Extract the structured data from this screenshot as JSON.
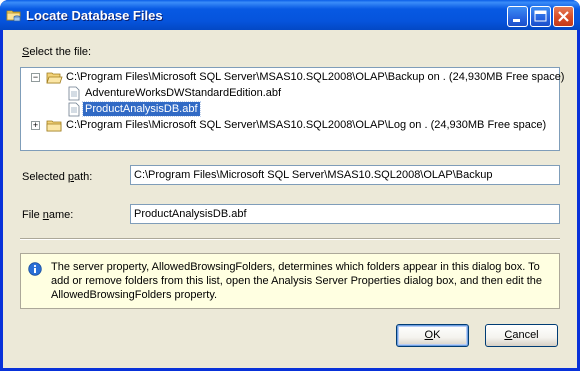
{
  "window": {
    "title": "Locate Database Files",
    "icon": "database-folder-icon"
  },
  "titlebar_buttons": {
    "minimize_icon": "minimize-icon",
    "maximize_icon": "maximize-icon",
    "close_icon": "close-icon"
  },
  "select_file": {
    "label_prefix": "",
    "label_mnemonic": "S",
    "label_rest": "elect the file:"
  },
  "tree": {
    "nodes": [
      {
        "expander": "−",
        "text": "C:\\Program Files\\Microsoft SQL Server\\MSAS10.SQL2008\\OLAP\\Backup on . (24,930MB Free space)",
        "icon": "open-folder-icon",
        "children": [
          {
            "text": "AdventureWorksDWStandardEdition.abf",
            "icon": "file-icon",
            "selected": false
          },
          {
            "text": "ProductAnalysisDB.abf",
            "icon": "file-icon",
            "selected": true
          }
        ]
      },
      {
        "expander": "+",
        "text": "C:\\Program Files\\Microsoft SQL Server\\MSAS10.SQL2008\\OLAP\\Log on . (24,930MB Free space)",
        "icon": "closed-folder-icon",
        "children": []
      }
    ]
  },
  "selected_path": {
    "label_prefix": "Selected ",
    "label_mnemonic": "p",
    "label_rest": "ath:",
    "value": "C:\\Program Files\\Microsoft SQL Server\\MSAS10.SQL2008\\OLAP\\Backup"
  },
  "file_name": {
    "label_prefix": "File ",
    "label_mnemonic": "n",
    "label_rest": "ame:",
    "value": "ProductAnalysisDB.abf"
  },
  "info": {
    "icon": "info-icon",
    "text": "The server property, AllowedBrowsingFolders, determines which folders appear in this dialog box. To add or remove folders from this list, open the Analysis Server Properties dialog box, and then edit the AllowedBrowsingFolders property."
  },
  "buttons": {
    "ok_mnemonic": "O",
    "ok_rest": "K",
    "cancel_prefix": "",
    "cancel_mnemonic": "C",
    "cancel_rest": "ancel"
  },
  "colors": {
    "title_bar": "#0654dc",
    "dialog_bg": "#ece9d8",
    "selection": "#316ac5",
    "info_bg": "#ffffe1"
  }
}
